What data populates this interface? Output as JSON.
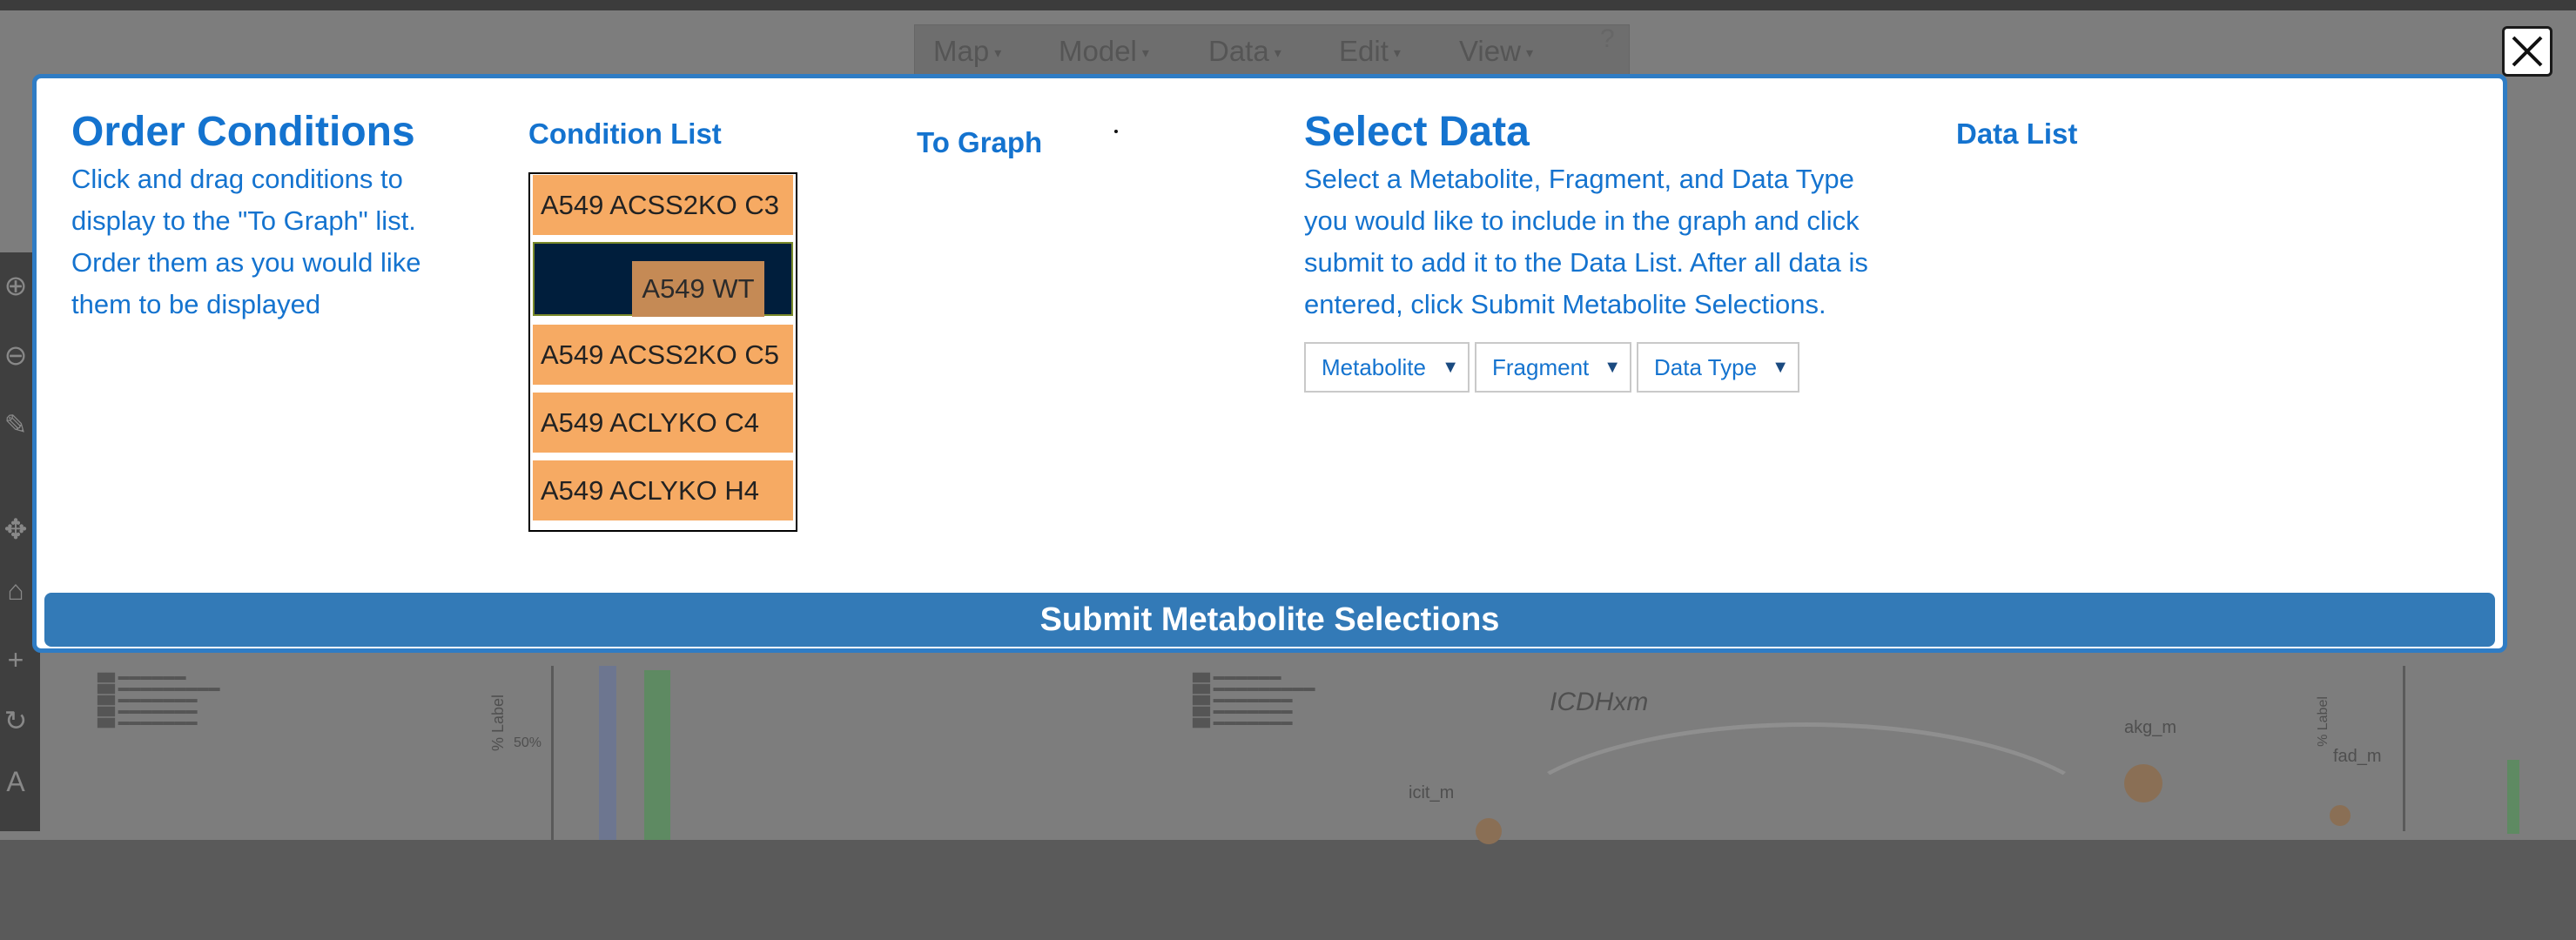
{
  "background": {
    "menu": [
      {
        "label": "Map"
      },
      {
        "label": "Model"
      },
      {
        "label": "Data"
      },
      {
        "label": "Edit"
      },
      {
        "label": "View"
      }
    ],
    "help_symbol": "?",
    "reaction_label": "ICDHxm",
    "metabolite_labels": {
      "akg": "akg_m",
      "icit": "icit_m",
      "fad": "fad_m",
      "label": "% Label"
    },
    "axis_labels": {
      "left": "% Label",
      "right": "% Label"
    },
    "tick_label": "50%"
  },
  "modal": {
    "close_icon": "close-x-icon",
    "order_conditions": {
      "title": "Order Conditions",
      "description": "Click and drag conditions to display to the \"To Graph\" list. Order them as you would like them to be displayed"
    },
    "condition_list": {
      "title": "Condition List",
      "items": [
        {
          "label": "A549 ACSS2KO C3"
        },
        {
          "label": ""
        },
        {
          "label": "A549 ACSS2KO C5"
        },
        {
          "label": "A549 ACLYKO C4"
        },
        {
          "label": "A549 ACLYKO H4"
        }
      ],
      "dragging_label": "A549 WT"
    },
    "to_graph": {
      "title": "To Graph"
    },
    "select_data": {
      "title": "Select Data",
      "description": "Select a Metabolite, Fragment, and Data Type you would like to include in the graph and click submit to add it to the Data List. After all data is entered, click Submit Metabolite Selections.",
      "selects": [
        {
          "label": "Metabolite"
        },
        {
          "label": "Fragment"
        },
        {
          "label": "Data Type"
        }
      ]
    },
    "data_list": {
      "title": "Data List"
    },
    "submit_label": "Submit Metabolite Selections"
  },
  "colors": {
    "accent": "#1473cf",
    "modal_border": "#2f7cc4",
    "condition_item": "#f6aa63",
    "selected_item": "#001e3c",
    "submit_button": "#337ab7"
  }
}
